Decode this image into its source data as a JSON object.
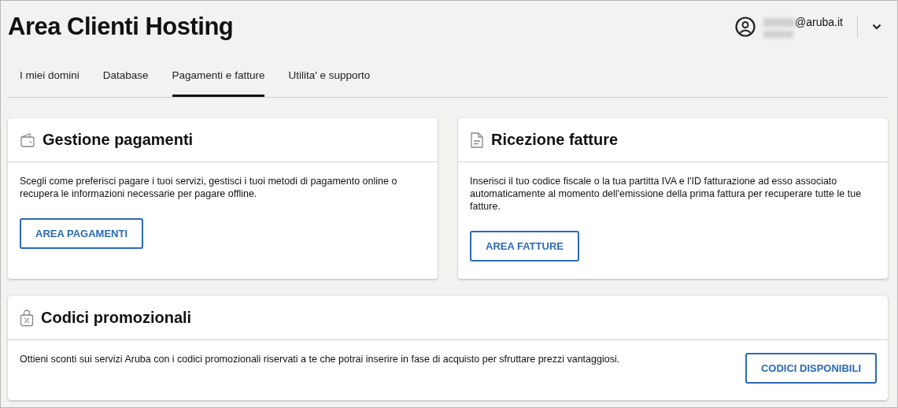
{
  "header": {
    "title": "Area Clienti Hosting",
    "user": {
      "email_suffix": "@aruba.it"
    }
  },
  "tabs": [
    {
      "label": "I miei domini",
      "selected": false
    },
    {
      "label": "Database",
      "selected": false
    },
    {
      "label": "Pagamenti e fatture",
      "selected": true
    },
    {
      "label": "Utilita' e supporto",
      "selected": false
    }
  ],
  "cards": [
    {
      "kind": "payments",
      "title": "Gestione pagamenti",
      "text": "Scegli come preferisci pagare i tuoi servizi, gestisci i tuoi metodi di pagamento online o recupera le informazioni necessarie per pagare offline.",
      "button": "AREA PAGAMENTI"
    },
    {
      "kind": "invoices",
      "title": "Ricezione fatture",
      "text": "Inserisci il tuo codice fiscale o la tua partitta IVA e l'ID fatturazione ad esso associato automaticamente al momento dell'emissione della prima fattura per recuperare tutte le tue fatture.",
      "button": "AREA FATTURE"
    }
  ],
  "promo": {
    "title": "Codici promozionali",
    "text": "Ottieni sconti sui servizi Aruba con i codici promozionali riservati a te che potrai inserire in fase di acquisto per sfruttare prezzi vantaggiosi.",
    "button": "CODICI DISPONIBILI"
  }
}
